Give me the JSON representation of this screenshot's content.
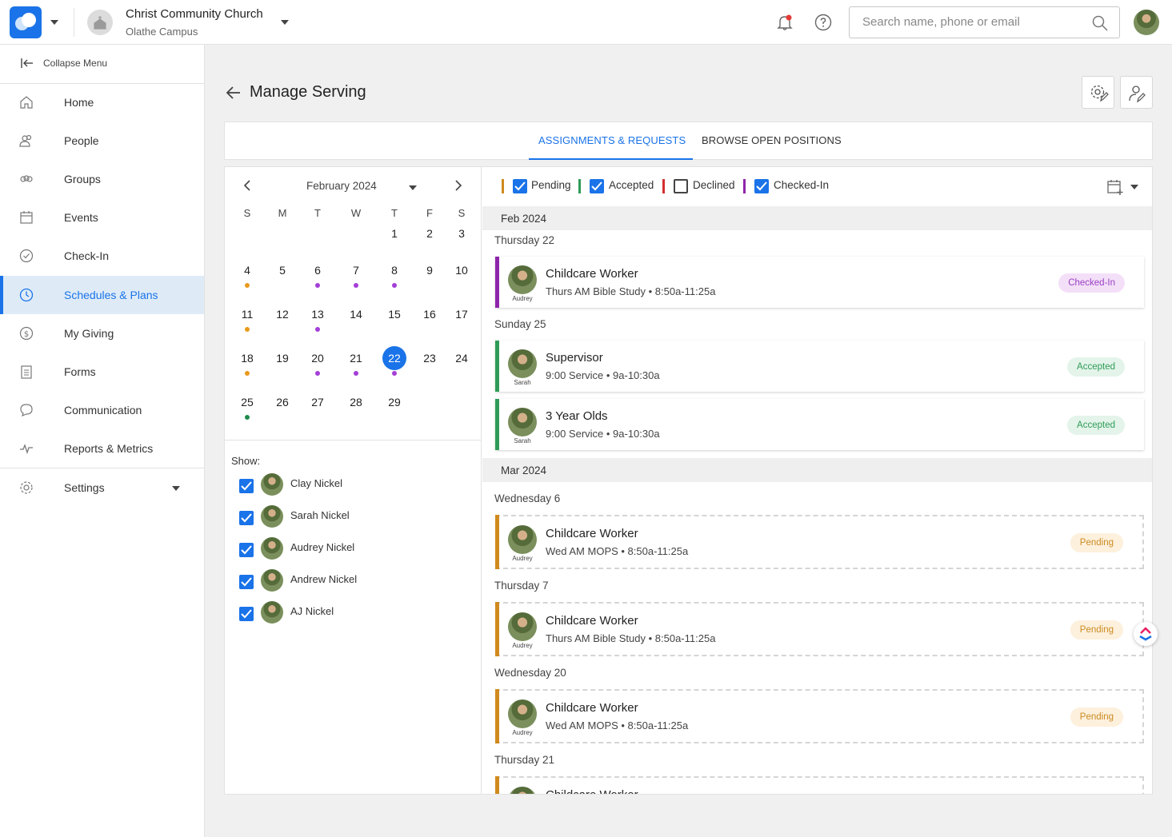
{
  "header": {
    "org_name": "Christ Community Church",
    "campus": "Olathe Campus",
    "search_placeholder": "Search name, phone or email"
  },
  "sidebar": {
    "collapse_label": "Collapse Menu",
    "items": [
      {
        "label": "Home",
        "icon": "home-icon"
      },
      {
        "label": "People",
        "icon": "people-icon"
      },
      {
        "label": "Groups",
        "icon": "groups-icon"
      },
      {
        "label": "Events",
        "icon": "events-icon"
      },
      {
        "label": "Check-In",
        "icon": "check-in-icon"
      },
      {
        "label": "Schedules & Plans",
        "icon": "clock-icon",
        "active": true
      },
      {
        "label": "My Giving",
        "icon": "dollar-icon"
      },
      {
        "label": "Forms",
        "icon": "forms-icon"
      },
      {
        "label": "Communication",
        "icon": "chat-icon"
      },
      {
        "label": "Reports & Metrics",
        "icon": "metrics-icon"
      }
    ],
    "settings_label": "Settings"
  },
  "page": {
    "title": "Manage Serving",
    "tabs": [
      "ASSIGNMENTS & REQUESTS",
      "BROWSE OPEN POSITIONS"
    ]
  },
  "calendar": {
    "month_label": "February 2024",
    "weekdays": [
      "S",
      "M",
      "T",
      "W",
      "T",
      "F",
      "S"
    ],
    "days": [
      "1",
      "2",
      "3",
      "4",
      "5",
      "6",
      "7",
      "8",
      "9",
      "10",
      "11",
      "12",
      "13",
      "14",
      "15",
      "16",
      "17",
      "18",
      "19",
      "20",
      "21",
      "22",
      "23",
      "24",
      "25",
      "26",
      "27",
      "28",
      "29"
    ],
    "selected_day": "22",
    "show_label": "Show:",
    "people": [
      "Clay Nickel",
      "Sarah Nickel",
      "Audrey Nickel",
      "Andrew Nickel",
      "AJ Nickel"
    ]
  },
  "legend": {
    "items": [
      {
        "label": "Pending",
        "color": "#d08a1e",
        "checked": true
      },
      {
        "label": "Accepted",
        "color": "#2e9c57",
        "checked": true
      },
      {
        "label": "Declined",
        "color": "#d32f2f",
        "checked": false
      },
      {
        "label": "Checked-In",
        "color": "#8e24aa",
        "checked": true
      }
    ]
  },
  "schedule": {
    "feb_header": "Feb 2024",
    "mar_header": "Mar 2024",
    "days": {
      "thu22": "Thursday 22",
      "sun25": "Sunday 25",
      "wed6": "Wednesday 6",
      "thu7": "Thursday 7",
      "wed20": "Wednesday 20",
      "thu21": "Thursday 21"
    },
    "cards": [
      {
        "role": "Childcare Worker",
        "detail": "Thurs AM Bible Study • 8:50a-11:25a",
        "person": "Audrey",
        "status": "Checked-In"
      },
      {
        "role": "Supervisor",
        "detail": "9:00 Service • 9a-10:30a",
        "person": "Sarah",
        "status": "Accepted"
      },
      {
        "role": "3 Year Olds",
        "detail": "9:00 Service • 9a-10:30a",
        "person": "Sarah",
        "status": "Accepted"
      },
      {
        "role": "Childcare Worker",
        "detail": "Wed AM MOPS • 8:50a-11:25a",
        "person": "Audrey",
        "status": "Pending"
      },
      {
        "role": "Childcare Worker",
        "detail": "Thurs AM Bible Study • 8:50a-11:25a",
        "person": "Audrey",
        "status": "Pending"
      },
      {
        "role": "Childcare Worker",
        "detail": "Wed AM MOPS • 8:50a-11:25a",
        "person": "Audrey",
        "status": "Pending"
      },
      {
        "role": "Childcare Worker"
      }
    ]
  },
  "colors": {
    "accent": "#1a73e8",
    "pending": "#d08a1e",
    "accepted": "#2e9c57",
    "checked_in": "#8e24aa",
    "declined": "#d32f2f"
  }
}
